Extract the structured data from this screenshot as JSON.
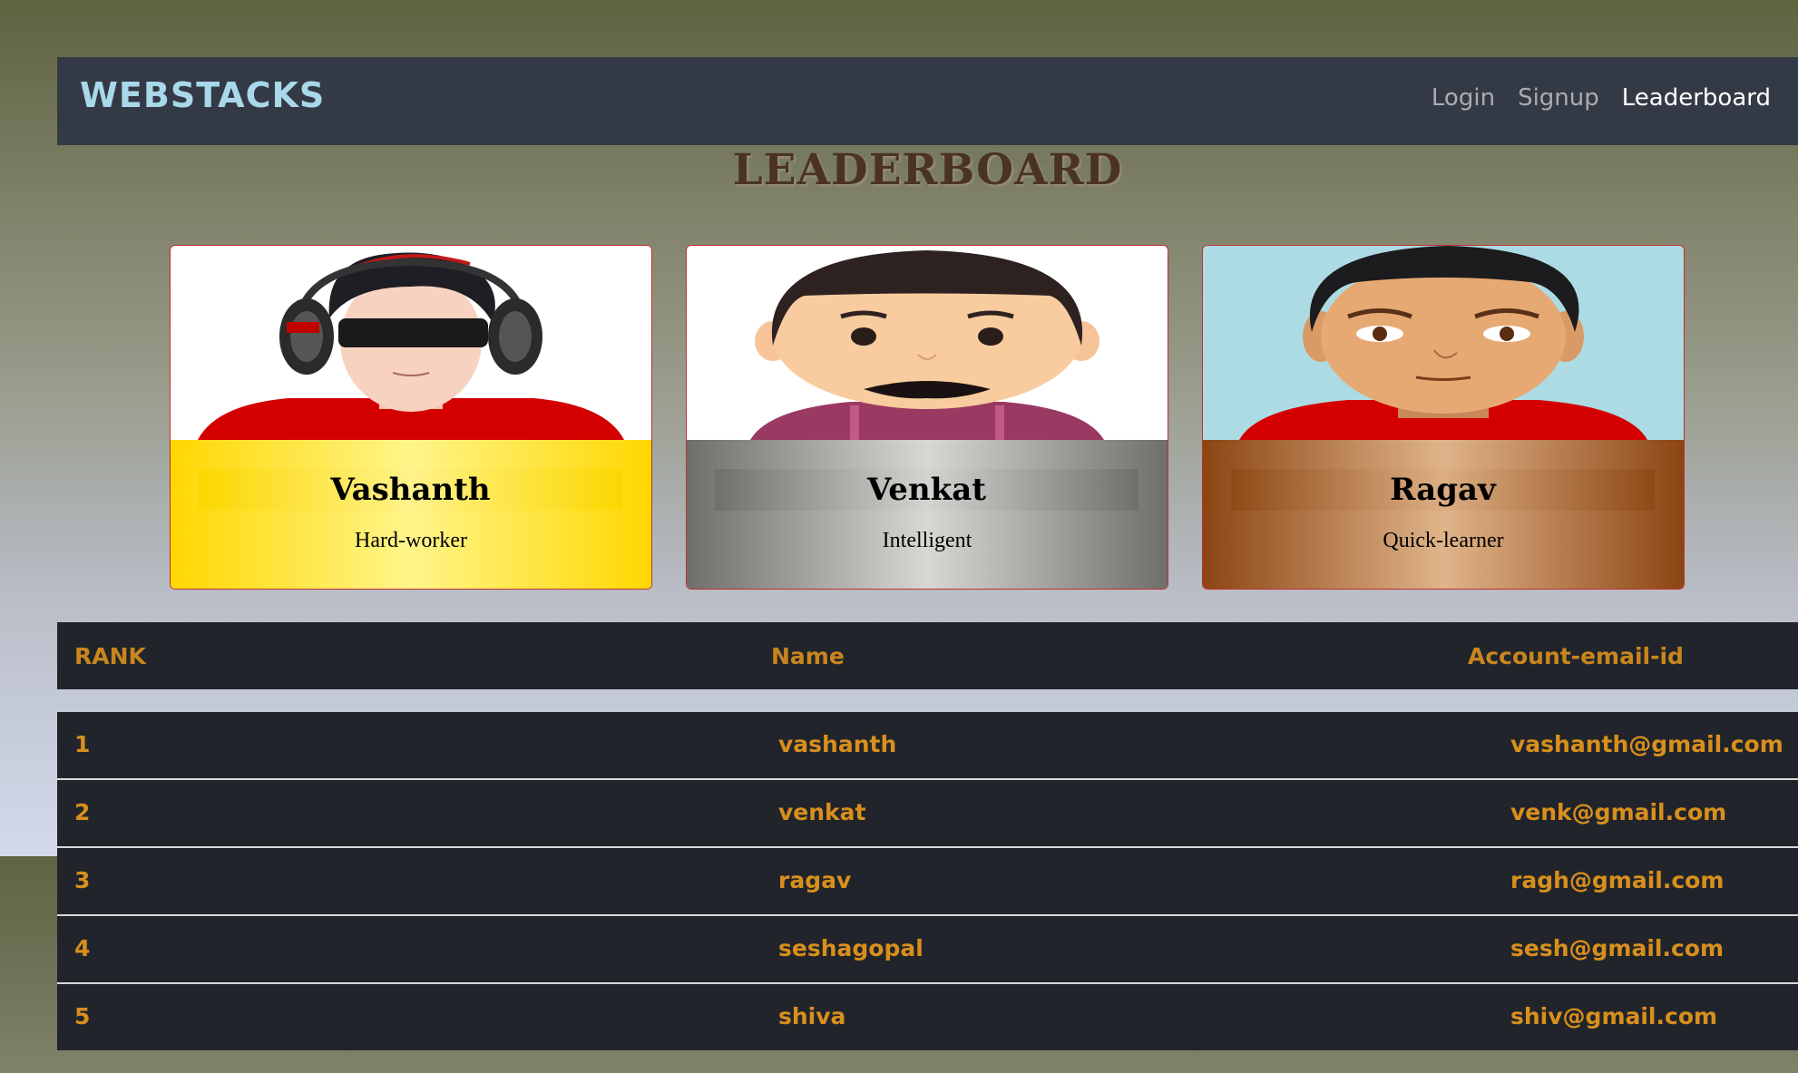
{
  "navbar": {
    "brand": "WEBSTACKS",
    "links": [
      {
        "label": "Login"
      },
      {
        "label": "Signup"
      },
      {
        "label": "Leaderboard"
      }
    ]
  },
  "page": {
    "title": "LEADERBOARD"
  },
  "cards": [
    {
      "name": "Vashanth",
      "desc": "Hard-worker",
      "tier": "gold"
    },
    {
      "name": "Venkat",
      "desc": "Intelligent",
      "tier": "silver"
    },
    {
      "name": "Ragav",
      "desc": "Quick-learner",
      "tier": "bronze"
    }
  ],
  "table": {
    "headers": {
      "rank": "RANK",
      "name": "Name",
      "email": "Account-email-id"
    },
    "rows": [
      {
        "rank": "1",
        "name": "vashanth",
        "email": "vashanth@gmail.com"
      },
      {
        "rank": "2",
        "name": "venkat",
        "email": "venk@gmail.com"
      },
      {
        "rank": "3",
        "name": "ragav",
        "email": "ragh@gmail.com"
      },
      {
        "rank": "4",
        "name": "seshagopal",
        "email": "sesh@gmail.com"
      },
      {
        "rank": "5",
        "name": "shiva",
        "email": "shiv@gmail.com"
      }
    ]
  },
  "colors": {
    "navbar_bg": "#343a45",
    "brand": "#a8d8ea",
    "table_bg": "#21252b",
    "table_text": "#d98f1c",
    "title": "#4a3421"
  }
}
